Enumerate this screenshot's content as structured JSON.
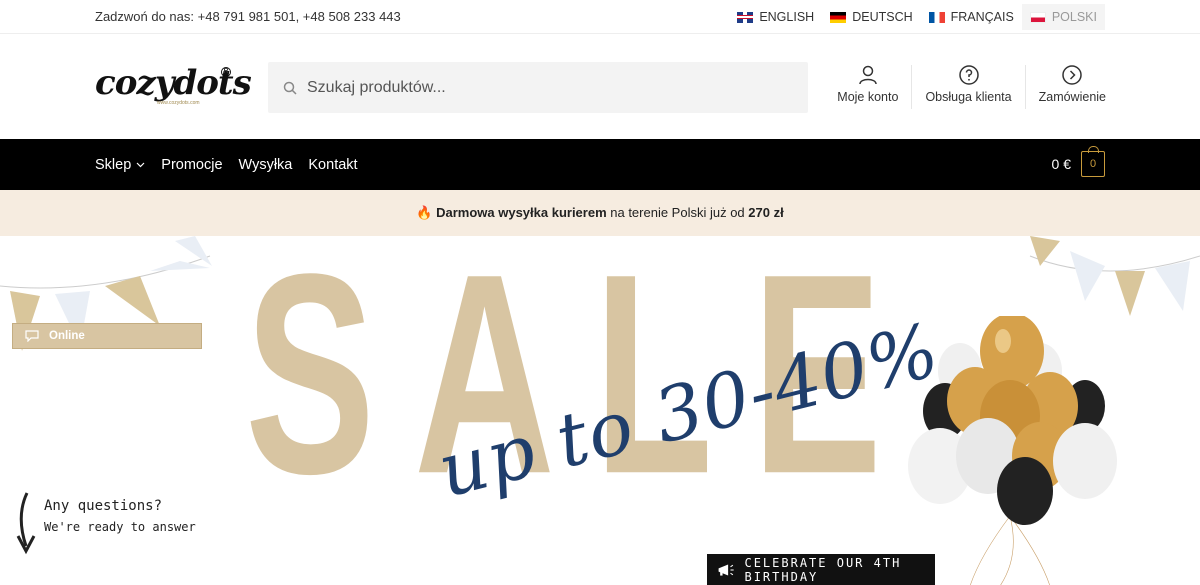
{
  "topbar": {
    "phone": "Zadzwoń do nas: +48 791 981 501, +48 508 233 443",
    "languages": [
      {
        "label": "ENGLISH",
        "flag": "gb-flag-icon"
      },
      {
        "label": "DEUTSCH",
        "flag": "de-flag-icon"
      },
      {
        "label": "FRANÇAIS",
        "flag": "fr-flag-icon"
      },
      {
        "label": "POLSKI",
        "flag": "pl-flag-icon",
        "active": true
      }
    ]
  },
  "header": {
    "logo_text": "cozydots",
    "logo_sub": "www.cozydots.com",
    "search": {
      "placeholder": "Szukaj produktów..."
    },
    "links": [
      {
        "label": "Moje konto",
        "icon": "user-icon"
      },
      {
        "label": "Obsługa klienta",
        "icon": "help-icon"
      },
      {
        "label": "Zamówienie",
        "icon": "chevron-right-circle-icon"
      }
    ]
  },
  "nav": {
    "items": [
      {
        "label": "Sklep",
        "has_dropdown": true
      },
      {
        "label": "Promocje"
      },
      {
        "label": "Wysyłka"
      },
      {
        "label": "Kontakt"
      }
    ],
    "cart_total": "0 €",
    "cart_count": "0"
  },
  "promo": {
    "bold1": "Darmowa wysyłka kurierem",
    "middle": " na terenie Polski już od ",
    "bold2": "270 zł"
  },
  "hero": {
    "headline": "SALE",
    "subline": "up to 30-40%",
    "question": "Any questions?",
    "answer": "We're ready to answer",
    "celebrate": "CELEBRATE OUR 4TH BIRTHDAY"
  },
  "chat": {
    "label": "Online"
  },
  "colors": {
    "accent_gold": "#c89b3c",
    "sale_beige": "#d8c5a2",
    "navy": "#1f3e6c",
    "promo_bg": "#f6ece0"
  }
}
